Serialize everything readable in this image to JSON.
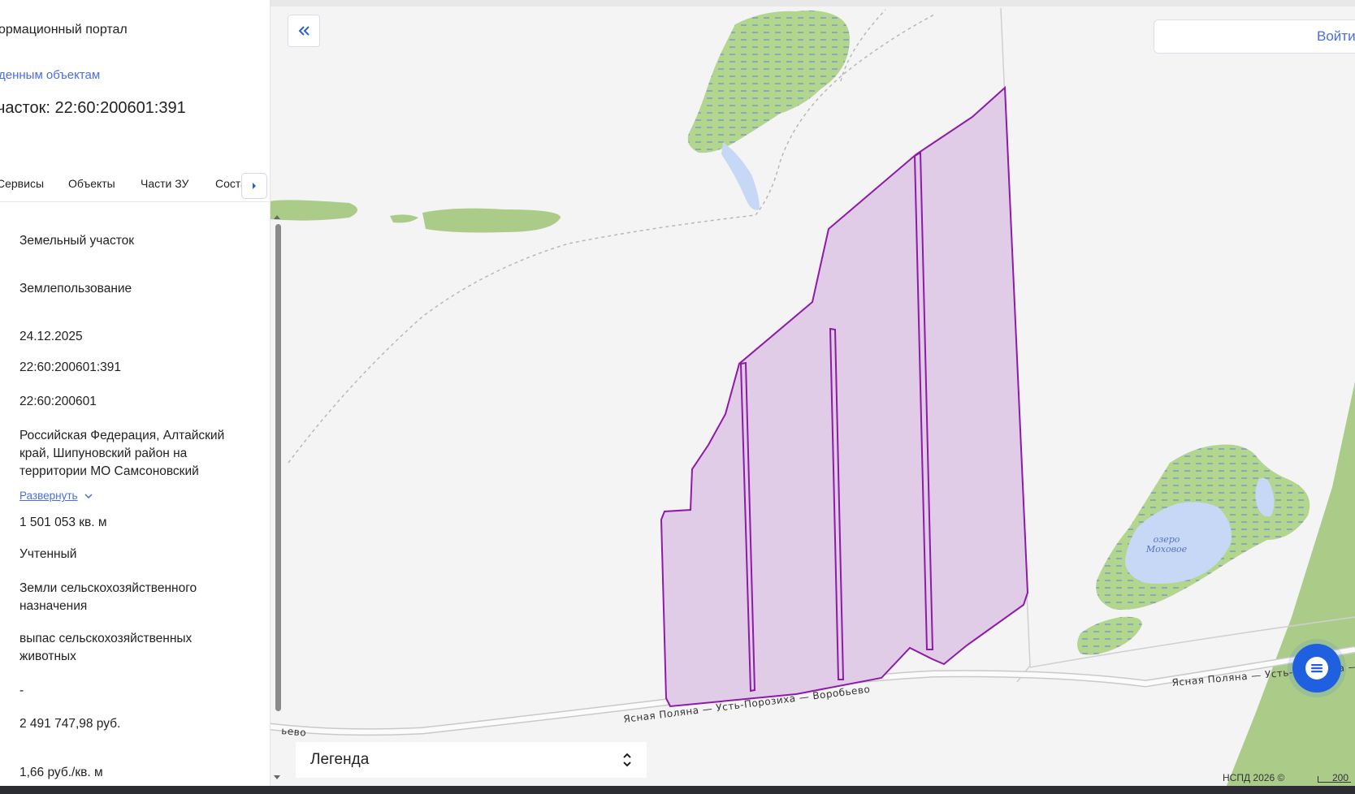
{
  "panel": {
    "portal_title": "ормационный портал",
    "back_link": "денным объектам",
    "parcel_heading": "часток: 22:60:200601:391",
    "tabs": [
      "Сервисы",
      "Объекты",
      "Части ЗУ",
      "Состав"
    ],
    "fields": {
      "object_type": "Земельный участок",
      "right_type": "Землепользование",
      "date": "24.12.2025",
      "cadastral_number": "22:60:200601:391",
      "quarter": "22:60:200601",
      "address": "Российская Федерация, Алтайский край, Шипуновский район на территории МО Самсоновский",
      "expand_link": "Развернуть",
      "area": "1 501 053 кв. м",
      "status": "Учтенный",
      "category": "Земли сельскохозяйственного назначения",
      "permitted_use": "выпас сельскохозяйственных животных",
      "dash": "-",
      "cadastral_value": "2 491 747,98 руб.",
      "specific_value": "1,66 руб./кв. м"
    }
  },
  "map": {
    "login_button": "Войти",
    "legend_label": "Легенда",
    "road_label_main": "Ясная Поляна — Усть-Порозиха — Воробьево",
    "road_label_right": "Ясная Поляна — Усть-Порозиха — Воро",
    "road_label_left": "ьево",
    "lake_label_line1": "озеро",
    "lake_label_line2": "Моховое",
    "attribution": "НСПД 2026 ©",
    "scale_label": "200",
    "colors": {
      "parcel_fill": "#e0cce6",
      "parcel_stroke": "#8e1aa8",
      "wetland": "#b3d68e",
      "water": "#c6d8f5",
      "field_green": "#aacc88",
      "accent": "#4a6ee0",
      "chat": "#1e60e0"
    },
    "icons": [
      "double-chevron-left-icon",
      "chevron-up-down-icon",
      "chat-icon",
      "chevron-right-icon",
      "chevron-down-icon"
    ]
  }
}
